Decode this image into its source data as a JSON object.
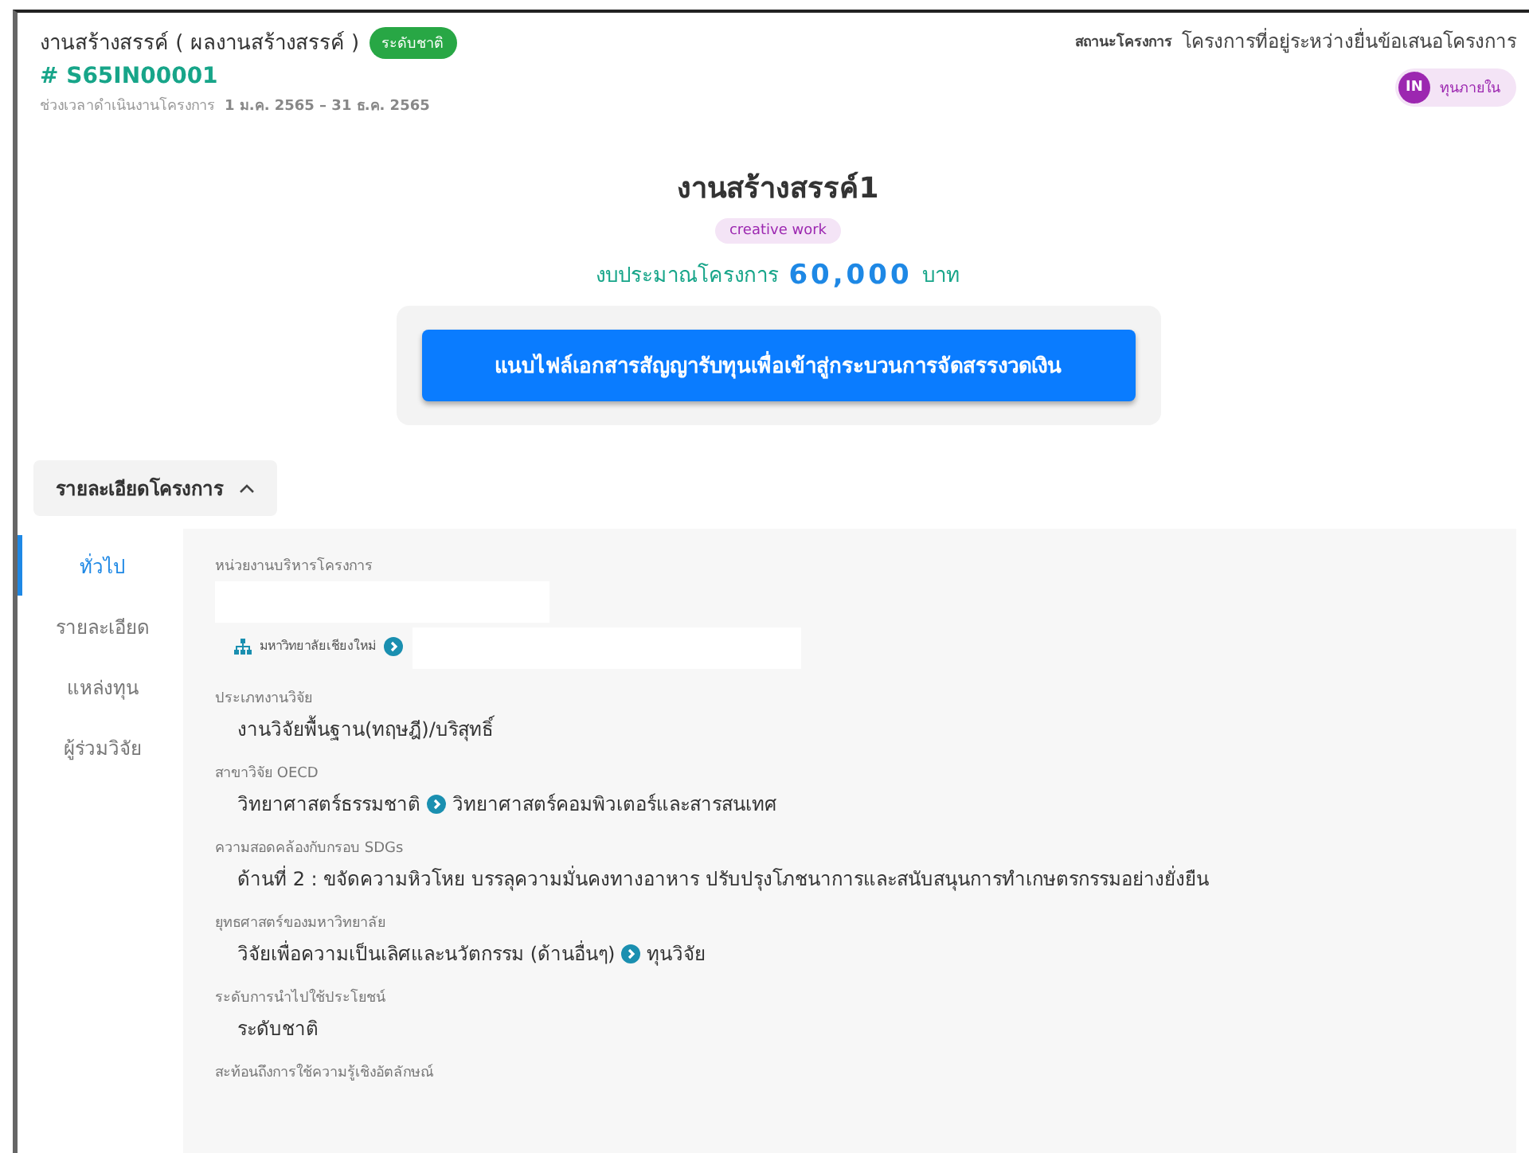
{
  "header": {
    "title": "งานสร้างสรรค์ ( ผลงานสร้างสรรค์ )",
    "level_badge": "ระดับชาติ",
    "code": "# S65IN00001",
    "period_label": "ช่วงเวลาดำเนินงานโครงการ",
    "period": "1 ม.ค. 2565 – 31 ธ.ค. 2565",
    "status_label": "สถานะโครงการ",
    "status": "โครงการที่อยู่ระหว่างยื่นข้อเสนอโครงการ",
    "fund_avatar": "IN",
    "fund_type": "ทุนภายใน"
  },
  "project": {
    "name": "งานสร้างสรรค์1",
    "tag": "creative work",
    "budget_label": "งบประมาณโครงการ",
    "budget": "60,000",
    "currency": "บาท",
    "action": "แนบไฟล์เอกสารสัญญารับทุนเพื่อเข้าสู่กระบวนการจัดสรรงวดเงิน"
  },
  "section": {
    "title": "รายละเอียดโครงการ",
    "expanded": true
  },
  "tabs": [
    {
      "label": "ทั่วไป",
      "selected": true
    },
    {
      "label": "รายละเอียด",
      "selected": false
    },
    {
      "label": "แหล่งทุน",
      "selected": false
    },
    {
      "label": "ผู้ร่วมวิจัย",
      "selected": false
    }
  ],
  "fields": [
    {
      "label": "หน่วยงานบริหารโครงการ",
      "kind": "org",
      "parts": [
        "มหาวิทยาลัยเชียงใหม่"
      ]
    },
    {
      "label": "ประเภทงานวิจัย",
      "kind": "text",
      "parts": [
        "งานวิจัยพื้นฐาน(ทฤษฎี)/บริสุทธิ์"
      ]
    },
    {
      "label": "สาขาวิจัย OECD",
      "kind": "text",
      "parts": [
        "วิทยาศาสตร์ธรรมชาติ",
        "วิทยาศาสตร์คอมพิวเตอร์และสารสนเทศ"
      ]
    },
    {
      "label": "ความสอดคล้องกับกรอบ SDGs",
      "kind": "text",
      "parts": [
        "ด้านที่ 2 : ขจัดความหิวโหย บรรลุความมั่นคงทางอาหาร ปรับปรุงโภชนาการและสนับสนุนการทำเกษตรกรรมอย่างยั่งยืน"
      ]
    },
    {
      "label": "ยุทธศาสตร์ของมหาวิทยาลัย",
      "kind": "text",
      "parts": [
        "วิจัยเพื่อความเป็นเลิศและนวัตกรรม (ด้านอื่นๆ)",
        "ทุนวิจัย"
      ]
    },
    {
      "label": "ระดับการนำไปใช้ประโยชน์",
      "kind": "text",
      "parts": [
        "ระดับชาติ"
      ]
    },
    {
      "label": "สะท้อนถึงการใช้ความรู้เชิงอัตลักษณ์",
      "kind": "text"
    }
  ]
}
